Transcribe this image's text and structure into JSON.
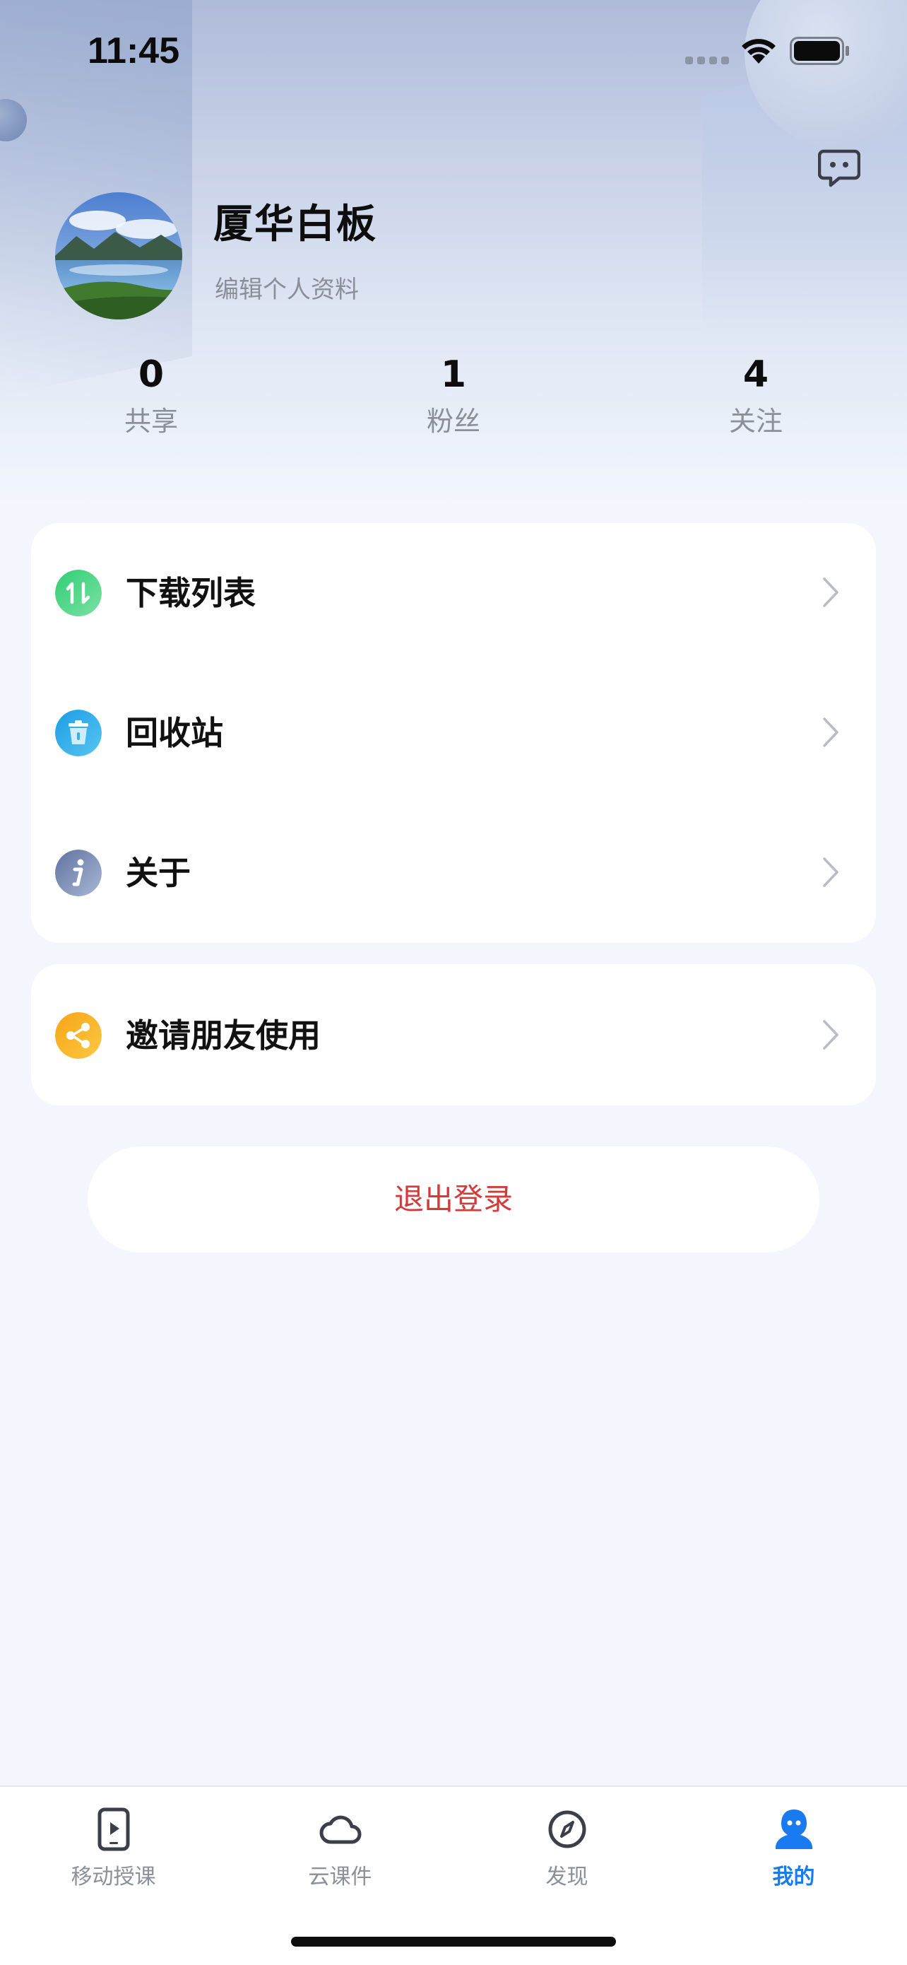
{
  "status_bar": {
    "time": "11:45"
  },
  "profile": {
    "name": "厦华白板",
    "edit_link": "编辑个人资料"
  },
  "stats": [
    {
      "value": "0",
      "label": "共享"
    },
    {
      "value": "1",
      "label": "粉丝"
    },
    {
      "value": "4",
      "label": "关注"
    }
  ],
  "menu": {
    "items": [
      {
        "label": "下载列表",
        "icon": "download-list-icon",
        "color": "#3cc97a"
      },
      {
        "label": "回收站",
        "icon": "trash-icon",
        "color": "#27a9ea"
      },
      {
        "label": "关于",
        "icon": "info-icon",
        "color": "#7c8fb3"
      }
    ],
    "invite": {
      "label": "邀请朋友使用",
      "icon": "share-icon",
      "color": "#f9b21d"
    }
  },
  "logout": {
    "label": "退出登录",
    "color": "#d43a3a"
  },
  "tab_bar": {
    "tabs": [
      {
        "label": "移动授课",
        "icon": "play-tablet-icon"
      },
      {
        "label": "云课件",
        "icon": "cloud-icon"
      },
      {
        "label": "发现",
        "icon": "compass-icon"
      },
      {
        "label": "我的",
        "icon": "person-icon",
        "active": true
      }
    ],
    "active_color": "#1a7bf0"
  }
}
